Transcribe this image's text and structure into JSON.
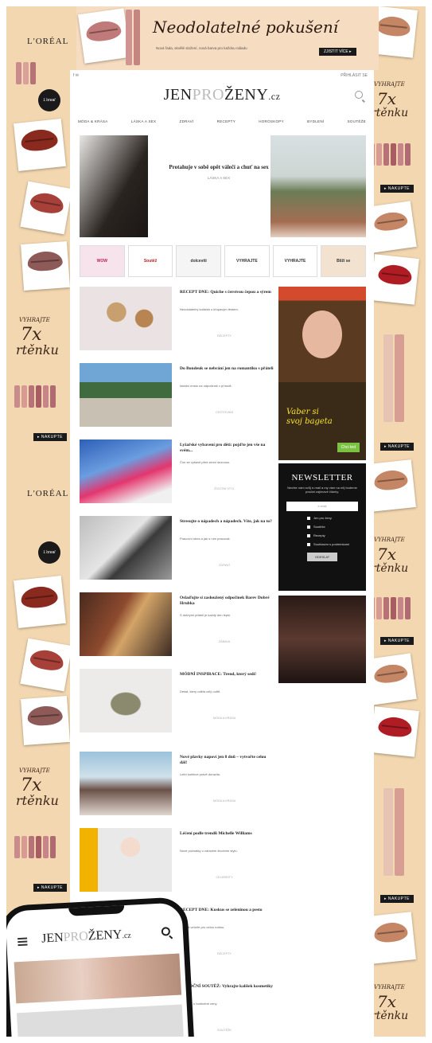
{
  "banner": {
    "title": "Neodolatelné pokušení",
    "sub": "Nová řada, skvělé složení, nová barva pro každou náladu",
    "cta": "ZJISTIT VÍCE ▸"
  },
  "skin": {
    "brand": "L'ORÉAL",
    "promo_line1": "VYHRAJTE",
    "promo_big": "7x",
    "promo_line2": "rtěnku",
    "cta": "▸ NAKUPTE",
    "badge": "L'oreal"
  },
  "site": {
    "logo_a": "JEN",
    "logo_b": "PRO",
    "logo_c": "ŽENY",
    "logo_tld": ".cz",
    "util_left": "f  ✉",
    "util_right": "PŘIHLÁSIT SE",
    "nav": [
      "MÓDA & KRÁSA",
      "LÁSKA A SEX",
      "ZDRAVÍ",
      "RECEPTY",
      "HOROSKOPY",
      "BYDLENÍ",
      "SOUTĚŽE"
    ],
    "hero": {
      "title": "Protahuje v sobě opět válečí a chuť na sex",
      "meta": "LÁSKA A SEX"
    },
    "ad_strip": [
      "WOW",
      "Soutěž",
      "dolceviti",
      "VYHRAJTE",
      "VYHRAJTE",
      "Blíží se"
    ]
  },
  "articles": [
    {
      "title": "RECEPT DNE: Quiche s čerstvou čepou a sýrem",
      "excerpt": "Neodolatelný koláček s křupavým těstem.",
      "meta": "RECEPTY"
    },
    {
      "title": "Do Bondeuk se nebrání jen na romantiku s přáteli",
      "excerpt": "Ideální místo na odpočinek v přírodě.",
      "meta": "CESTOVÁNÍ"
    },
    {
      "title": "Lyžařské vybavení pro děti: pojďte jen vše na svém...",
      "excerpt": "Čím se vybavit před zimní sezonou.",
      "meta": "ŽIVOTNÍ STYL"
    },
    {
      "title": "Stresujte o nápadech a nápadech. Víte, jak na to?",
      "excerpt": "Pracovní stres a jak s ním pracovat.",
      "meta": "ZDRAVÍ"
    },
    {
      "title": "Oslaďujte si zasloužený odpočinek Barev Dobré Hrubka",
      "excerpt": "S dobrými přáteli je každý den lepší.",
      "meta": "ZÁBAVA"
    },
    {
      "title": "MÓDNÍ INSPIRACE: Trend, který sedí!",
      "excerpt": "Detail, který udělá celý outfit.",
      "meta": "MÓDA A KRÁSA"
    },
    {
      "title": "Nové plavky napoví jen 8 dnů – vytvořte celou dál!",
      "excerpt": "Letní kolekce právě dorazila.",
      "meta": "MÓDA A KRÁSA"
    },
    {
      "title": "Léčení podle trendů Michelle Williams",
      "excerpt": "Nové poznatky o zdravém životním stylu.",
      "meta": "CELEBRITY"
    },
    {
      "title": "RECEPT DNE: Kuskus se zeleninou a pesto",
      "excerpt": "Rychlá večeře pro celou rodinu.",
      "meta": "RECEPTY"
    },
    {
      "title": "VÁNOČNÍ SOUTĚŽ: Vyhrajte kalíšek kosmetiky",
      "excerpt": "Soutěžte o hodnotné ceny.",
      "meta": "SOUTĚŽE"
    }
  ],
  "sidebar": {
    "ad1_line1": "Vaber si",
    "ad1_line2": "svoj bageta",
    "ad1_btn": "Chci ted",
    "newsletter_title": "NEWSLETTER",
    "newsletter_desc": "Nechte nám svůj e-mail a my vám na něj budeme posílat zajímavé články.",
    "email_placeholder": "e-mail",
    "options": [
      "Jen pro ženy",
      "Soutěže",
      "Recepty"
    ],
    "consent": "Souhlasím s podmínkami",
    "submit": "ODESLAT"
  },
  "phone": {
    "logo": "JENPROŽENY.cz"
  }
}
